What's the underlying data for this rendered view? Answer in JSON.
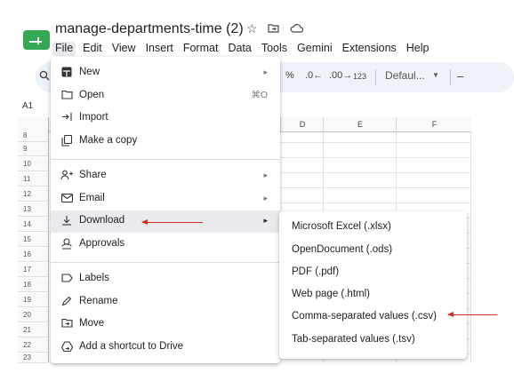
{
  "document": {
    "title": "manage-departments-time (2)"
  },
  "title_icons": [
    "star-icon",
    "move-to-folder-icon",
    "cloud-status-icon"
  ],
  "menubar": [
    "File",
    "Edit",
    "View",
    "Insert",
    "Format",
    "Data",
    "Tools",
    "Gemini",
    "Extensions",
    "Help"
  ],
  "toolbar": {
    "percent": "%",
    "dec_decrease": ".0←",
    "dec_increase": ".00→",
    "number_format": "123",
    "font": "Defaul...",
    "minus": "–"
  },
  "name_box": "A1",
  "columns": [
    "D",
    "E",
    "F"
  ],
  "rows": [
    "8",
    "9",
    "10",
    "11",
    "12",
    "13",
    "14",
    "15",
    "16",
    "17",
    "18",
    "19",
    "20",
    "21",
    "22",
    "23"
  ],
  "file_menu": {
    "new": {
      "label": "New",
      "icon": "new-sheet-icon"
    },
    "open": {
      "label": "Open",
      "shortcut": "⌘O",
      "icon": "folder-icon"
    },
    "import": {
      "label": "Import",
      "icon": "import-icon"
    },
    "make_copy": {
      "label": "Make a copy",
      "icon": "copy-icon"
    },
    "share": {
      "label": "Share",
      "icon": "share-icon"
    },
    "email": {
      "label": "Email",
      "icon": "email-icon"
    },
    "download": {
      "label": "Download",
      "icon": "download-icon"
    },
    "approvals": {
      "label": "Approvals",
      "icon": "approvals-icon"
    },
    "labels": {
      "label": "Labels",
      "icon": "label-icon"
    },
    "rename": {
      "label": "Rename",
      "icon": "pencil-icon"
    },
    "move": {
      "label": "Move",
      "icon": "move-folder-icon"
    },
    "shortcut": {
      "label": "Add a shortcut to Drive",
      "icon": "drive-shortcut-icon"
    }
  },
  "download_submenu": [
    "Microsoft Excel (.xlsx)",
    "OpenDocument (.ods)",
    "PDF (.pdf)",
    "Web page (.html)",
    "Comma-separated values (.csv)",
    "Tab-separated values (.tsv)"
  ],
  "colors": {
    "annotation_arrow": "#d93025",
    "logo": "#34a853",
    "highlight": "#e8eaed"
  }
}
